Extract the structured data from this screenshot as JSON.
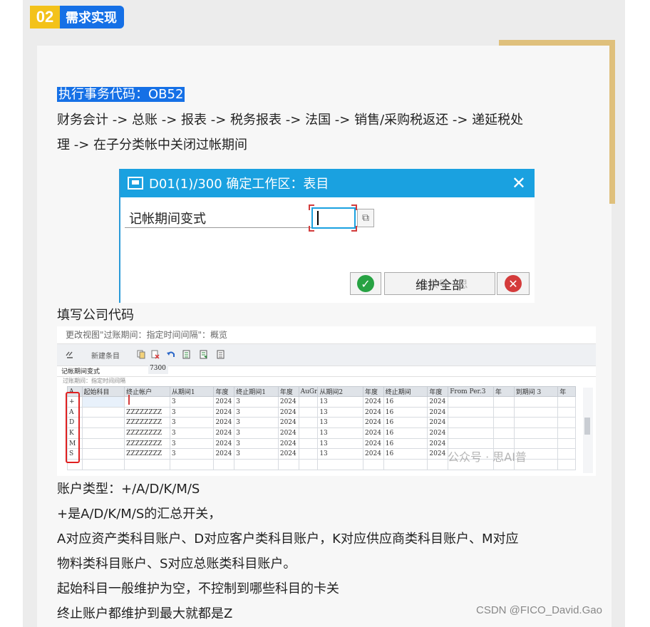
{
  "section": {
    "number": "02",
    "title": "需求实现"
  },
  "lines": {
    "tcode": "执行事务代码：OB52",
    "path1": "财务会计 -> 总账 -> 报表 -> 税务报表 -> 法国 -> 销售/采购税返还 -> 递延税处",
    "path2": "理 -> 在子分类帐中关闭过帐期间",
    "fill_company": "填写公司代码",
    "acct_types": "账户类型：+/A/D/K/M/S",
    "plus_desc": "+是A/D/K/M/S的汇总开关，",
    "map1": "A对应资产类科目账户、D对应客户类科目账户，K对应供应商类科目账户、M对应",
    "map2": "物料类科目账户、S对应总账类科目账户。",
    "from_acct": "起始科目一般维护为空，不控制到哪些科目的卡关",
    "to_acct": "终止账户都维护到最大就都是Z"
  },
  "dialog": {
    "title": "D01(1)/300 确定工作区：表目",
    "label": "记帐期间变式",
    "input_value": "",
    "btn_maintain_all": "维护全部"
  },
  "table_shot": {
    "title": "更改视图\"过账期间：指定时间间隔\"：概览",
    "new_entry": "新建条目",
    "field_label": "记帐期间变式",
    "field_value": "7300",
    "sub_caption": "过账期间：指定时间间隔",
    "columns": [
      "A",
      "起始科目",
      "终止帐户",
      "从期间1",
      "年度",
      "终止期间1",
      "年度",
      "AuGr",
      "从期间2",
      "年度",
      "终止期间",
      "年度",
      "From Per.3",
      "年",
      "到期间 3",
      "年"
    ],
    "rows": [
      [
        "+",
        "",
        "",
        "3",
        "2024",
        "3",
        "2024",
        "",
        "13",
        "2024",
        "16",
        "2024",
        "",
        "",
        "",
        ""
      ],
      [
        "A",
        "",
        "ZZZZZZZZ",
        "3",
        "2024",
        "3",
        "2024",
        "",
        "13",
        "2024",
        "16",
        "2024",
        "",
        "",
        "",
        ""
      ],
      [
        "D",
        "",
        "ZZZZZZZZ",
        "3",
        "2024",
        "3",
        "2024",
        "",
        "13",
        "2024",
        "16",
        "2024",
        "",
        "",
        "",
        ""
      ],
      [
        "K",
        "",
        "ZZZZZZZZ",
        "3",
        "2024",
        "3",
        "2024",
        "",
        "13",
        "2024",
        "16",
        "2024",
        "",
        "",
        "",
        ""
      ],
      [
        "M",
        "",
        "ZZZZZZZZ",
        "3",
        "2024",
        "3",
        "2024",
        "",
        "13",
        "2024",
        "16",
        "2024",
        "",
        "",
        "",
        ""
      ],
      [
        "S",
        "",
        "ZZZZZZZZ",
        "3",
        "2024",
        "3",
        "2024",
        "",
        "13",
        "2024",
        "16",
        "2024",
        "",
        "",
        "",
        ""
      ]
    ],
    "empty_rows": 1
  },
  "watermarks": {
    "dialog": "公众号 · 思",
    "table": "公众号 · 思AI普"
  },
  "footer": "CSDN @FICO_David.Gao",
  "colors": {
    "accent_yellow": "#f3c21a",
    "accent_blue": "#1570e6",
    "sap_title": "#1aa1e0",
    "highlight_red": "#e02020"
  }
}
